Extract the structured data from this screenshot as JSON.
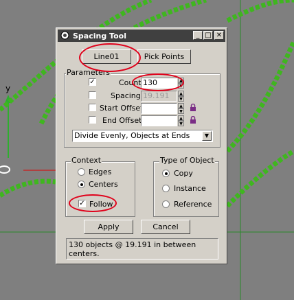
{
  "viewport": {
    "axis_label": "y",
    "colors": {
      "background": "#7f7f7f",
      "chain": "#3fb61f",
      "grid_line": "#2a8a2a",
      "axis_red": "#e00000"
    }
  },
  "dialog": {
    "title": "Spacing Tool",
    "title_buttons": [
      "minimize-icon",
      "maximize-icon",
      "close-icon"
    ],
    "pick_object_button": "Line01",
    "pick_points_button": "Pick Points",
    "parameters": {
      "label": "Parameters",
      "count": {
        "label": "Count:",
        "value": "130",
        "checked": true
      },
      "spacing": {
        "label": "Spacing:",
        "value": "19.191",
        "checked": false
      },
      "start_offset": {
        "label": "Start Offset:",
        "value": "",
        "checked": false
      },
      "end_offset": {
        "label": "End Offset:",
        "value": "",
        "checked": false
      },
      "distribution": "Divide Evenly, Objects at Ends"
    },
    "context": {
      "label": "Context",
      "options": [
        "Edges",
        "Centers"
      ],
      "selected": "Centers",
      "follow_label": "Follow",
      "follow_checked": true
    },
    "type_of_object": {
      "label": "Type of Object",
      "options": [
        "Copy",
        "Instance",
        "Reference"
      ],
      "selected": "Copy"
    },
    "apply_button": "Apply",
    "cancel_button": "Cancel",
    "status_text": "130 objects @ 19.191 in between centers."
  },
  "annotations": {
    "color": "#e0001a",
    "circled": [
      "pick-object-button",
      "count-field",
      "follow-checkbox"
    ]
  }
}
